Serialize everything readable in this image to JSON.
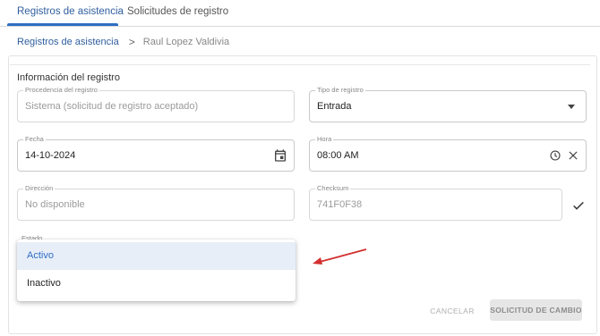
{
  "tabs": [
    {
      "label": "Registros de asistencia",
      "active": true
    },
    {
      "label": "Solicitudes de registro",
      "active": false
    }
  ],
  "breadcrumb": {
    "parent": "Registros de asistencia",
    "separator": ">",
    "current": "Raul Lopez Valdivia"
  },
  "section_title": "Información del registro",
  "fields": {
    "procedencia": {
      "label": "Procedencia del registro",
      "value": "Sistema (solicitud de registro aceptado)"
    },
    "tipo": {
      "label": "Tipo de registro",
      "value": "Entrada"
    },
    "fecha": {
      "label": "Fecha",
      "value": "14-10-2024"
    },
    "hora": {
      "label": "Hora",
      "value": "08:00 AM"
    },
    "direccion": {
      "label": "Dirección",
      "value": "No disponible"
    },
    "checksum": {
      "label": "Checksum",
      "value": "741F0F38"
    },
    "estado": {
      "label": "Estado"
    }
  },
  "dropdown": {
    "options": [
      "Activo",
      "Inactivo"
    ],
    "highlighted": "Activo"
  },
  "buttons": {
    "cancel": "CANCELAR",
    "change_request": "SOLICITUD DE CAMBIO"
  },
  "colors": {
    "accent": "#2f6ec4",
    "highlight_bg": "#e8eef8",
    "annotation_arrow": "#d32f2f"
  }
}
